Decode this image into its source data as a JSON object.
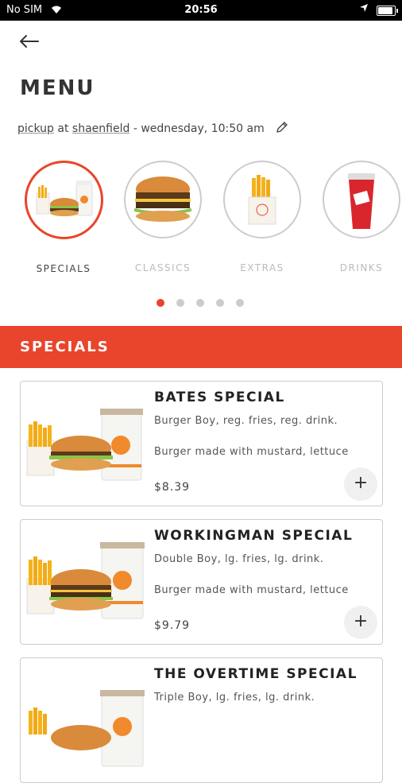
{
  "status_bar": {
    "carrier": "No SIM",
    "time": "20:56"
  },
  "header": {
    "title": "MENU",
    "order_info": {
      "mode": "pickup",
      "at": "at",
      "location": "shaenfield",
      "datetime": "- wednesday, 10:50 am"
    }
  },
  "categories": [
    {
      "label": "SPECIALS",
      "image": "combo-meal",
      "active": true
    },
    {
      "label": "CLASSICS",
      "image": "burger",
      "active": false
    },
    {
      "label": "EXTRAS",
      "image": "fries",
      "active": false
    },
    {
      "label": "DRINKS",
      "image": "drink-cup",
      "active": false
    }
  ],
  "pagination": {
    "count": 5,
    "active_index": 0
  },
  "section": {
    "title": "SPECIALS"
  },
  "items": [
    {
      "name": "BATES SPECIAL",
      "summary": "Burger Boy, reg. fries, reg. drink.",
      "description": "Burger made with mustard, lettuce",
      "price": "$8.39",
      "add_label": "+"
    },
    {
      "name": "WORKINGMAN SPECIAL",
      "summary": "Double Boy, lg. fries, lg. drink.",
      "description": "Burger made with mustard, lettuce",
      "price": "$9.79",
      "add_label": "+"
    },
    {
      "name": "THE OVERTIME SPECIAL",
      "summary": "Triple Boy, lg. fries, lg. drink.",
      "description": "",
      "price": "",
      "add_label": "+"
    }
  ],
  "colors": {
    "accent": "#e8452c"
  }
}
